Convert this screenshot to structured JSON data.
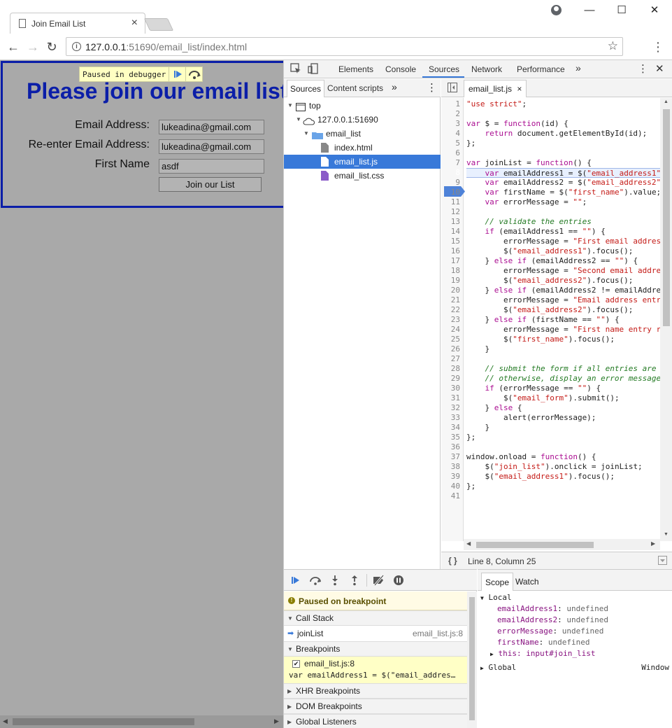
{
  "browser": {
    "tab_title": "Join Email List",
    "url_host": "127.0.0.1",
    "url_port": ":51690",
    "url_path": "/email_list/index.html"
  },
  "page": {
    "heading": "Please join our email list",
    "email_label": "Email Address:",
    "email_value": "lukeadina@gmail.com",
    "reenter_label": "Re-enter Email Address:",
    "reenter_value": "lukeadina@gmail.com",
    "first_name_label": "First Name",
    "first_name_value": "asdf",
    "join_button": "Join our List",
    "paused_overlay": "Paused in debugger"
  },
  "devtools": {
    "tabs": [
      "Elements",
      "Console",
      "Sources",
      "Network",
      "Performance"
    ],
    "active_tab": "Sources",
    "navigator_tabs": [
      "Sources",
      "Content scripts"
    ],
    "tree": {
      "top": "top",
      "host": "127.0.0.1:51690",
      "folder": "email_list",
      "files": [
        "index.html",
        "email_list.js",
        "email_list.css"
      ],
      "selected": "email_list.js"
    },
    "editor_tab": "email_list.js",
    "status": "Line 8, Column 25",
    "paused_banner": "Paused on breakpoint",
    "call_stack_label": "Call Stack",
    "call_stack": [
      {
        "fn": "joinList",
        "loc": "email_list.js:8"
      }
    ],
    "breakpoints_label": "Breakpoints",
    "breakpoint": {
      "file": "email_list.js:8",
      "source": "var emailAddress1 = $(\"email_addres…"
    },
    "xhr_label": "XHR Breakpoints",
    "dom_label": "DOM Breakpoints",
    "global_label": "Global Listeners",
    "scope_tabs": [
      "Scope",
      "Watch"
    ],
    "scope": {
      "local_label": "Local",
      "vars": [
        {
          "name": "emailAddress1",
          "value": "undefined"
        },
        {
          "name": "emailAddress2",
          "value": "undefined"
        },
        {
          "name": "errorMessage",
          "value": "undefined"
        },
        {
          "name": "firstName",
          "value": "undefined"
        }
      ],
      "this_label": "this: input#join_list",
      "global_label": "Global",
      "global_value": "Window"
    }
  },
  "code_lines": [
    "\"use strict\";",
    "",
    "var $ = function(id) {",
    "    return document.getElementById(id);",
    "};",
    "",
    "var joinList = function() {",
    "    var emailAddress1 = $(\"email_address1\"",
    "    var emailAddress2 = $(\"email_address2\"",
    "    var firstName = $(\"first_name\").value;",
    "    var errorMessage = \"\";",
    "",
    "    // validate the entries",
    "    if (emailAddress1 == \"\") {",
    "        errorMessage = \"First email addres",
    "        $(\"email_address1\").focus();",
    "    } else if (emailAddress2 == \"\") {",
    "        errorMessage = \"Second email addre",
    "        $(\"email_address2\").focus();",
    "    } else if (emailAddress2 != emailAddre",
    "        errorMessage = \"Email address entr",
    "        $(\"email_address2\").focus();",
    "    } else if (firstName == \"\") {",
    "        errorMessage = \"First name entry r",
    "        $(\"first_name\").focus();",
    "    }",
    "",
    "    // submit the form if all entries are",
    "    // otherwise, display an error message",
    "    if (errorMessage == \"\") {",
    "        $(\"email_form\").submit();",
    "    } else {",
    "        alert(errorMessage);",
    "    }",
    "};",
    "",
    "window.onload = function() {",
    "    $(\"join_list\").onclick = joinList;",
    "    $(\"email_address1\").focus();",
    "};",
    ""
  ],
  "breakpoint_line": 8,
  "colors": {
    "accent": "#3879d9",
    "page_heading": "#0b1ea8"
  }
}
